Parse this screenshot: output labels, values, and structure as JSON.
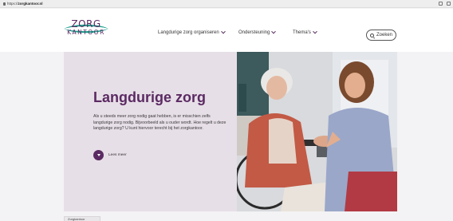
{
  "browser": {
    "url_prefix": "https://",
    "url_domain": "zorgkantoor.nl"
  },
  "header": {
    "logo_line1": "ZORG",
    "logo_line2": "KANTOOR",
    "nav": [
      {
        "label": "Langdurige zorg organiseren"
      },
      {
        "label": "Ondersteuning"
      },
      {
        "label": "Thema's"
      }
    ],
    "search_label": "Zoeken"
  },
  "hero": {
    "title": "Langdurige zorg",
    "text": "Als u steeds meer zorg nodig gaat hebben, is er misschien zelfs langdurige zorg nodig. Bijvoorbeeld als u ouder wordt. Hoe regelt u deze langdurige zorg? U kunt hiervoor terecht bij het zorgkantoor.",
    "readmore_label": "Lees meer"
  },
  "bottom_tab": {
    "label": "Zorgkantoor"
  },
  "colors": {
    "brand_purple": "#5b2a63",
    "brand_teal": "#1e9e8c",
    "hero_bg": "#e7dfe7"
  }
}
